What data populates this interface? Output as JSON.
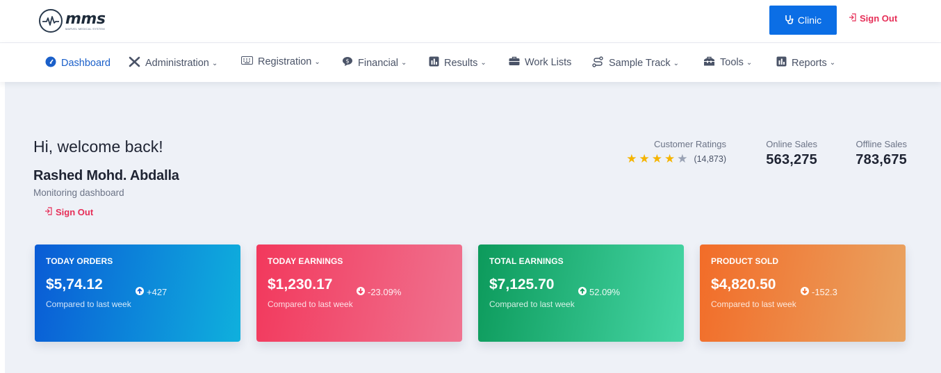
{
  "header": {
    "logo_text": "mms",
    "logo_subtitle": "MARVEL MEDICAL SYSTEM",
    "clinic_button": "Clinic",
    "sign_out": "Sign Out"
  },
  "nav": {
    "items": [
      {
        "label": "Dashboard",
        "icon": "dashboard-gauge-icon",
        "dropdown": false
      },
      {
        "label": "Administration",
        "icon": "tools-cross-icon",
        "dropdown": true
      },
      {
        "label": "Registration",
        "icon": "keyboard-icon",
        "dropdown": true
      },
      {
        "label": "Financial",
        "icon": "comment-dollar-icon",
        "dropdown": true
      },
      {
        "label": "Results",
        "icon": "chart-bar-icon",
        "dropdown": true
      },
      {
        "label": "Work Lists",
        "icon": "briefcase-icon",
        "dropdown": false
      },
      {
        "label": "Sample Track",
        "icon": "route-icon",
        "dropdown": true
      },
      {
        "label": "Tools",
        "icon": "toolbox-icon",
        "dropdown": true
      },
      {
        "label": "Reports",
        "icon": "chart-bar-icon",
        "dropdown": true
      }
    ]
  },
  "welcome": {
    "greeting": "Hi, welcome back!",
    "name": "Rashed Mohd. Abdalla",
    "subtitle": "Monitoring dashboard",
    "sign_out": "Sign Out"
  },
  "ratings": {
    "label": "Customer Ratings",
    "stars_filled": 4,
    "stars_total": 5,
    "count": "(14,873)"
  },
  "stats": {
    "online": {
      "label": "Online Sales",
      "value": "563,275"
    },
    "offline": {
      "label": "Offline Sales",
      "value": "783,675"
    }
  },
  "cards": [
    {
      "title": "TODAY ORDERS",
      "value": "$5,74.12",
      "note": "Compared to last week",
      "delta": "+427",
      "direction": "up",
      "gradient_from": "#0a5bd6",
      "gradient_to": "#0fb0dd"
    },
    {
      "title": "TODAY EARNINGS",
      "value": "$1,230.17",
      "note": "Compared to last week",
      "delta": "-23.09%",
      "direction": "down",
      "gradient_from": "#f2385c",
      "gradient_to": "#f07390"
    },
    {
      "title": "TOTAL EARNINGS",
      "value": "$7,125.70",
      "note": "Compared to last week",
      "delta": "52.09%",
      "direction": "up",
      "gradient_from": "#0c9a5b",
      "gradient_to": "#46d6a5"
    },
    {
      "title": "PRODUCT SOLD",
      "value": "$4,820.50",
      "note": "Compared to last week",
      "delta": "-152.3",
      "direction": "down",
      "gradient_from": "#f26c28",
      "gradient_to": "#e9a462"
    }
  ],
  "colors": {
    "primary": "#0b6ee5",
    "danger": "#e62e57",
    "star": "#f5b400",
    "star_empty": "#9aa3b5",
    "background": "#eef1f7"
  }
}
